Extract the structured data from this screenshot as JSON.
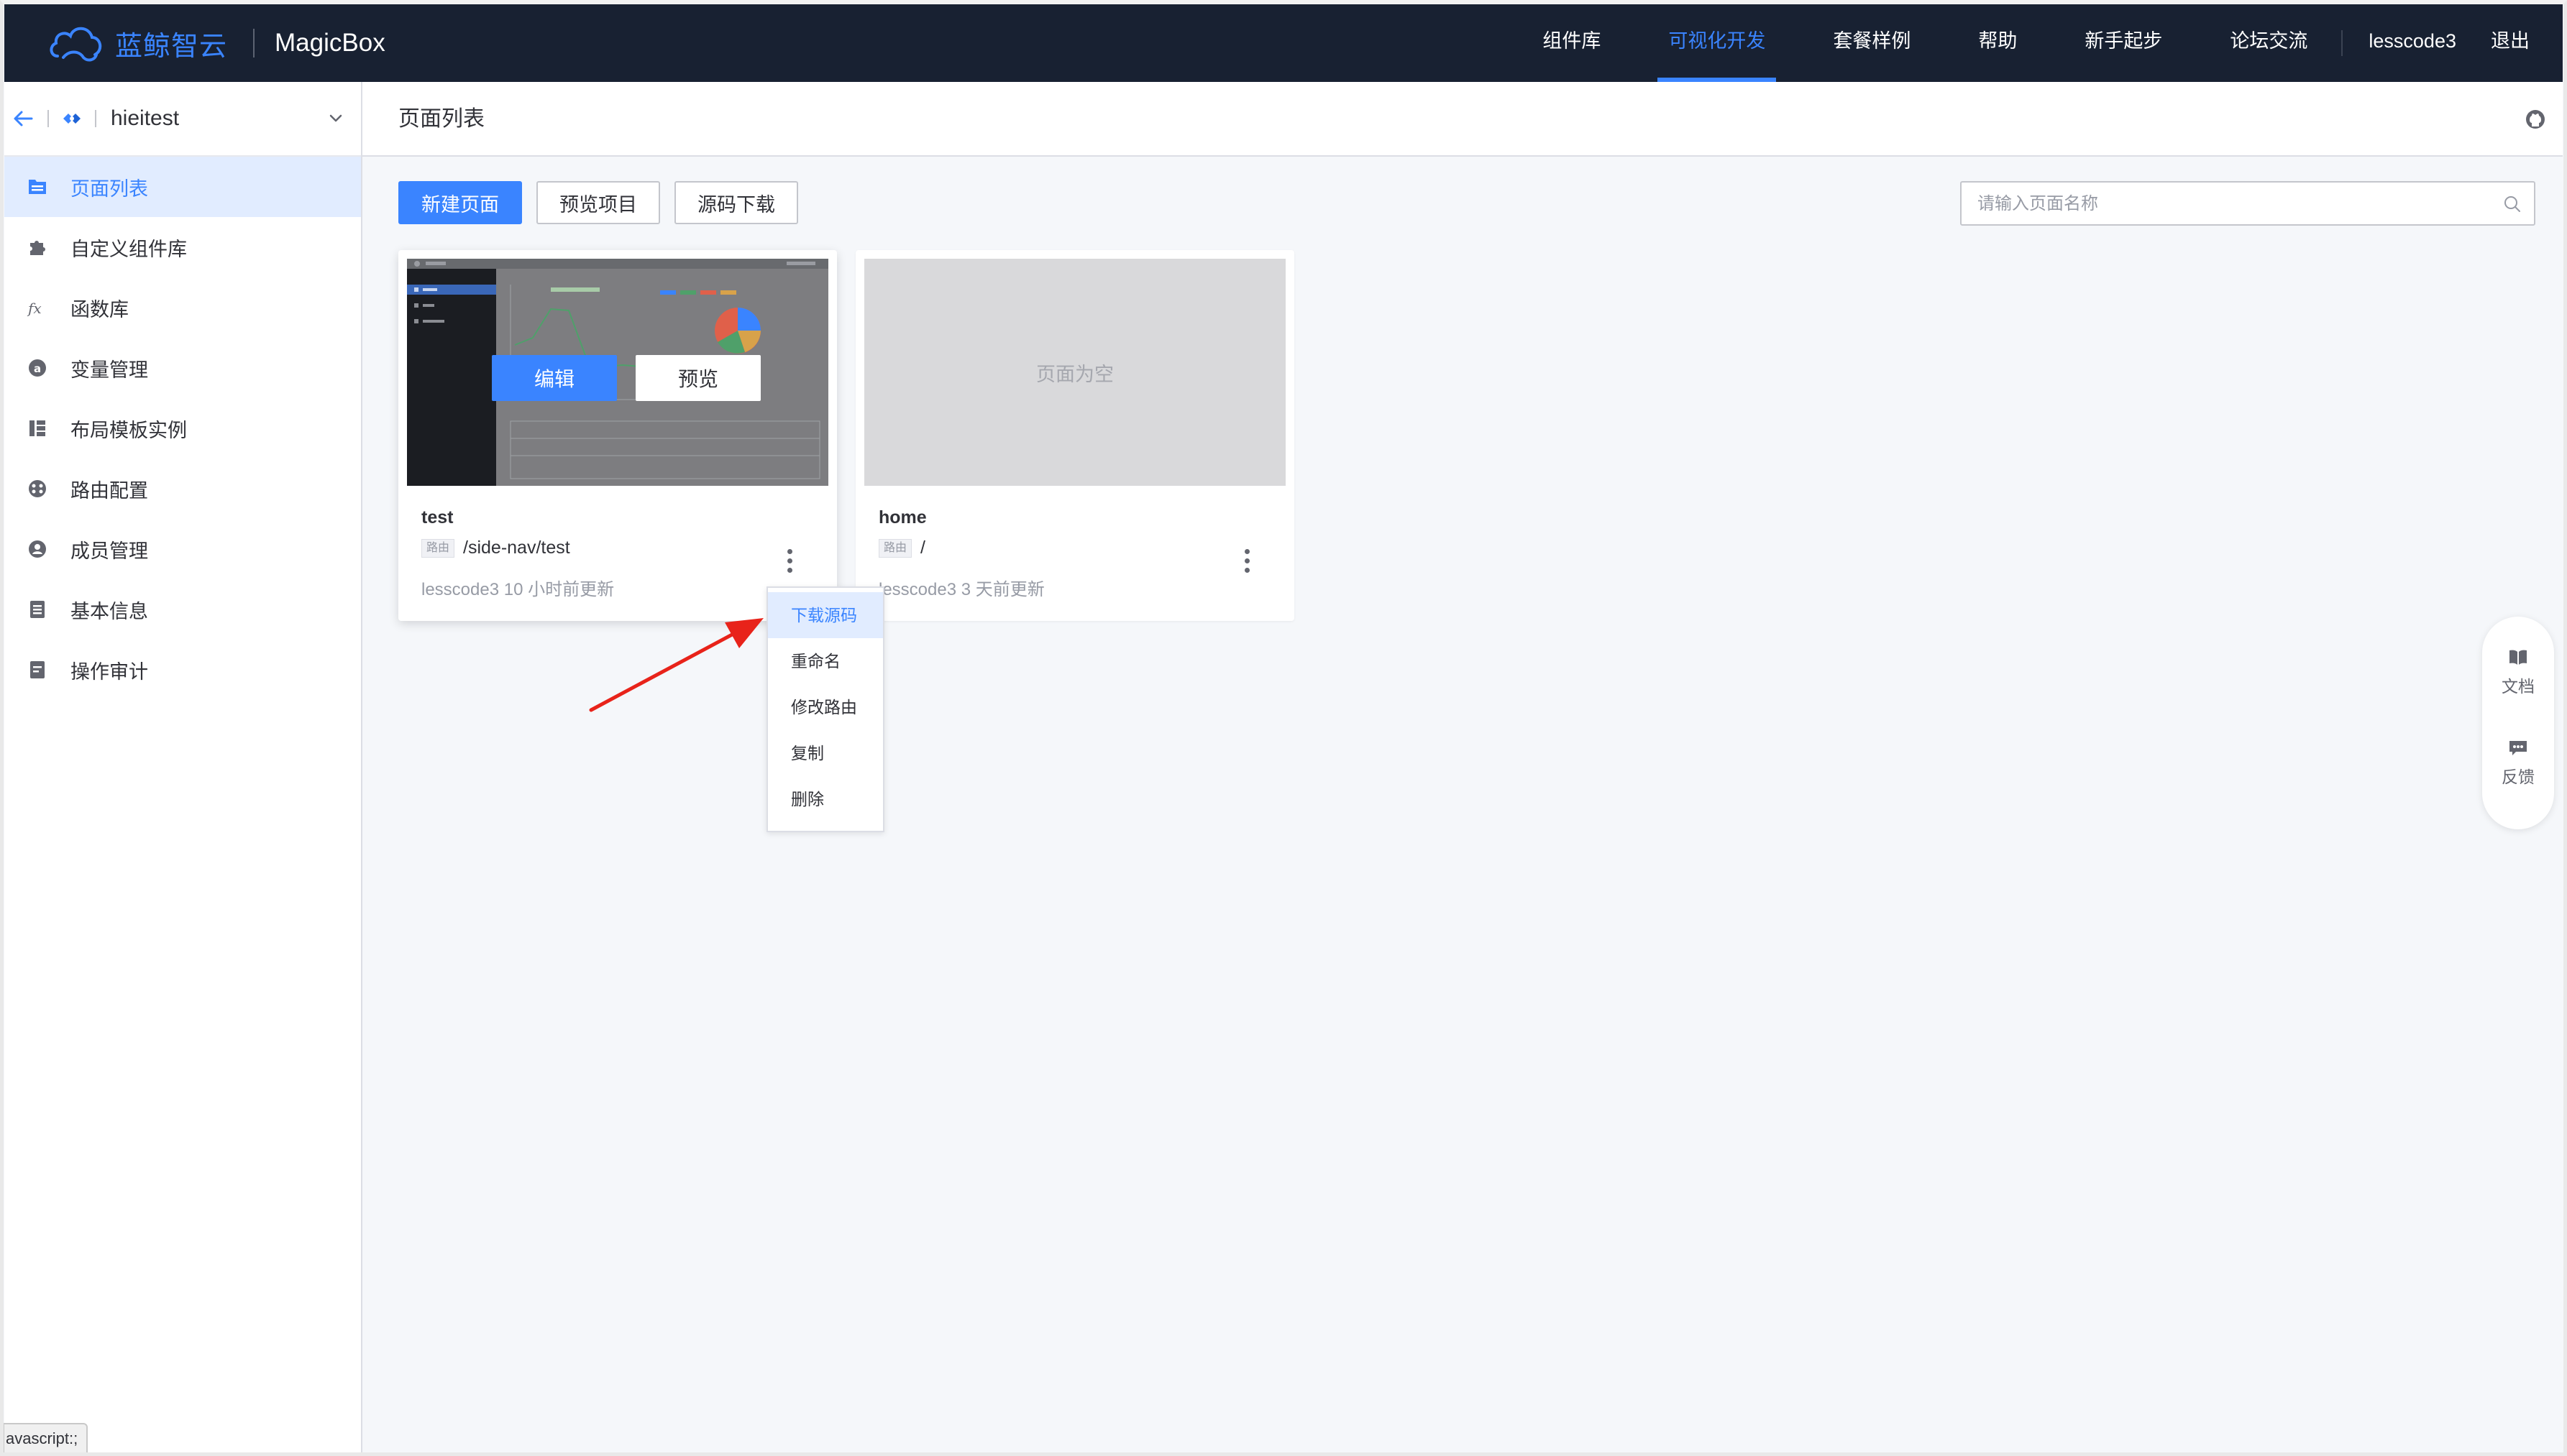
{
  "brand": {
    "logo_text": "蓝鲸智云",
    "product": "MagicBox"
  },
  "topnav": {
    "items": [
      "组件库",
      "可视化开发",
      "套餐样例",
      "帮助",
      "新手起步",
      "论坛交流"
    ],
    "active": "可视化开发",
    "user": "lesscode3",
    "logout": "退出"
  },
  "sidebar": {
    "project_name": "hieitest",
    "items": [
      {
        "label": "页面列表",
        "icon": "page-list-icon",
        "active": true
      },
      {
        "label": "自定义组件库",
        "icon": "puzzle-icon"
      },
      {
        "label": "函数库",
        "icon": "function-icon"
      },
      {
        "label": "变量管理",
        "icon": "variable-icon"
      },
      {
        "label": "布局模板实例",
        "icon": "layout-icon"
      },
      {
        "label": "路由配置",
        "icon": "route-icon"
      },
      {
        "label": "成员管理",
        "icon": "member-icon"
      },
      {
        "label": "基本信息",
        "icon": "info-icon"
      },
      {
        "label": "操作审计",
        "icon": "audit-icon"
      }
    ]
  },
  "header": {
    "title": "页面列表"
  },
  "toolbar": {
    "new_page": "新建页面",
    "preview_project": "预览项目",
    "download_source": "源码下载",
    "search_placeholder": "请输入页面名称"
  },
  "cards": [
    {
      "name": "test",
      "route_tag": "路由",
      "route": "/side-nav/test",
      "meta": "lesscode3 10 小时前更新",
      "edit_label": "编辑",
      "preview_label": "预览"
    },
    {
      "name": "home",
      "route_tag": "路由",
      "route": "/",
      "meta": "lesscode3 3 天前更新",
      "empty_label": "页面为空"
    }
  ],
  "dropdown": {
    "items": [
      "下载源码",
      "重命名",
      "修改路由",
      "复制",
      "删除"
    ],
    "active": "下载源码"
  },
  "float_help": {
    "docs": "文档",
    "feedback": "反馈"
  },
  "status_bar": "avascript:;",
  "colors": {
    "accent": "#3a84ff",
    "nav_bg": "#182132",
    "annotation_arrow": "#e8231a"
  }
}
